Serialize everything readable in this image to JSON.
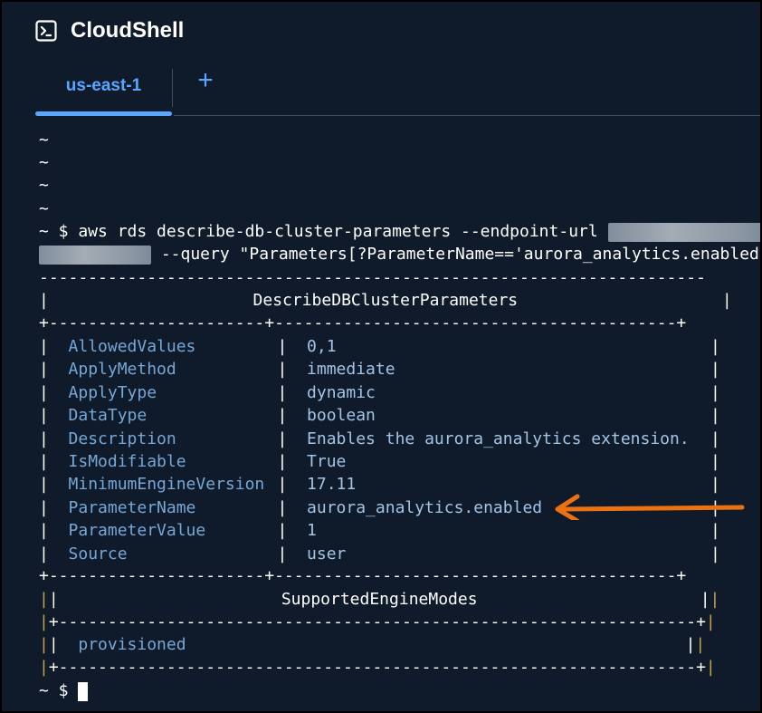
{
  "app": {
    "title": "CloudShell",
    "icon": "terminal-icon"
  },
  "tabs": [
    {
      "label": "us-east-1",
      "active": true
    }
  ],
  "add_tab": "+",
  "terminal": {
    "tildes": [
      "~",
      "~",
      "~",
      "~"
    ],
    "command_prefix": "~ $ aws rds describe-db-cluster-parameters --endpoint-url ",
    "command_cont": " --query \"Parameters[?ParameterName=='aurora_analytics.enabled'",
    "table_title": "DescribeDBClusterParameters",
    "rows": [
      {
        "key": "AllowedValues",
        "value": "0,1"
      },
      {
        "key": "ApplyMethod",
        "value": "immediate"
      },
      {
        "key": "ApplyType",
        "value": "dynamic"
      },
      {
        "key": "DataType",
        "value": "boolean"
      },
      {
        "key": "Description",
        "value": "Enables the aurora_analytics extension."
      },
      {
        "key": "IsModifiable",
        "value": "True"
      },
      {
        "key": "MinimumEngineVersion",
        "value": "17.11"
      },
      {
        "key": "ParameterName",
        "value": "aurora_analytics.enabled"
      },
      {
        "key": "ParameterValue",
        "value": "1"
      },
      {
        "key": "Source",
        "value": "user"
      }
    ],
    "sub_table_title": "SupportedEngineModes",
    "sub_table_value": "provisioned",
    "prompt": "~ $"
  },
  "colors": {
    "background": "#0f1b2a",
    "accent": "#5aa6ff",
    "arrow": "#ec7211"
  }
}
